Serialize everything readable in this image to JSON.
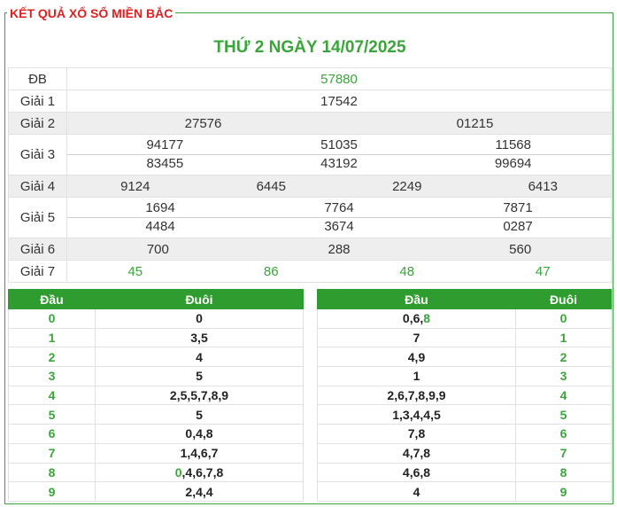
{
  "header": {
    "title": "KẾT QUẢ XỔ SỐ MIỀN BẮC",
    "date_title": "THỨ 2 NGÀY 14/07/2025"
  },
  "results": {
    "db": {
      "label": "ĐB",
      "values": [
        "57880"
      ]
    },
    "g1": {
      "label": "Giải 1",
      "values": [
        "17542"
      ]
    },
    "g2": {
      "label": "Giải 2",
      "values": [
        "27576",
        "01215"
      ]
    },
    "g3": {
      "label": "Giải 3",
      "row1": [
        "94177",
        "51035",
        "11568"
      ],
      "row2": [
        "83455",
        "43192",
        "99694"
      ]
    },
    "g4": {
      "label": "Giải 4",
      "values": [
        "9124",
        "6445",
        "2249",
        "6413"
      ]
    },
    "g5": {
      "label": "Giải 5",
      "row1": [
        "1694",
        "7764",
        "7871"
      ],
      "row2": [
        "4484",
        "3674",
        "0287"
      ]
    },
    "g6": {
      "label": "Giải 6",
      "values": [
        "700",
        "288",
        "560"
      ]
    },
    "g7": {
      "label": "Giải 7",
      "values": [
        "45",
        "86",
        "48",
        "47"
      ]
    }
  },
  "loto_left": {
    "head_col": "Đầu",
    "tail_col": "Đuôi",
    "rows": [
      {
        "idx": "0",
        "pre": "",
        "hl": "",
        "val": "0"
      },
      {
        "idx": "1",
        "pre": "",
        "hl": "",
        "val": "3,5"
      },
      {
        "idx": "2",
        "pre": "",
        "hl": "",
        "val": "4"
      },
      {
        "idx": "3",
        "pre": "",
        "hl": "",
        "val": "5"
      },
      {
        "idx": "4",
        "pre": "",
        "hl": "",
        "val": "2,5,5,7,8,9"
      },
      {
        "idx": "5",
        "pre": "",
        "hl": "",
        "val": "5"
      },
      {
        "idx": "6",
        "pre": "",
        "hl": "",
        "val": "0,4,8"
      },
      {
        "idx": "7",
        "pre": "",
        "hl": "",
        "val": "1,4,6,7"
      },
      {
        "idx": "8",
        "pre": "",
        "hl": "0",
        "val": ",4,6,7,8"
      },
      {
        "idx": "9",
        "pre": "",
        "hl": "",
        "val": "2,4,4"
      }
    ]
  },
  "loto_right": {
    "head_col": "Đầu",
    "tail_col": "Đuôi",
    "rows": [
      {
        "idx": "0",
        "pre": "0,6,",
        "hl": "8",
        "val": ""
      },
      {
        "idx": "1",
        "pre": "",
        "hl": "",
        "val": "7"
      },
      {
        "idx": "2",
        "pre": "",
        "hl": "",
        "val": "4,9"
      },
      {
        "idx": "3",
        "pre": "",
        "hl": "",
        "val": "1"
      },
      {
        "idx": "4",
        "pre": "",
        "hl": "",
        "val": "2,6,7,8,9,9"
      },
      {
        "idx": "5",
        "pre": "",
        "hl": "",
        "val": "1,3,4,4,5"
      },
      {
        "idx": "6",
        "pre": "",
        "hl": "",
        "val": "7,8"
      },
      {
        "idx": "7",
        "pre": "",
        "hl": "",
        "val": "4,7,8"
      },
      {
        "idx": "8",
        "pre": "",
        "hl": "",
        "val": "4,6,8"
      },
      {
        "idx": "9",
        "pre": "",
        "hl": "",
        "val": "4"
      }
    ]
  },
  "colors": {
    "accent_green": "#3aa53a",
    "title_red": "#e02020",
    "header_green": "#2e9c2e"
  }
}
